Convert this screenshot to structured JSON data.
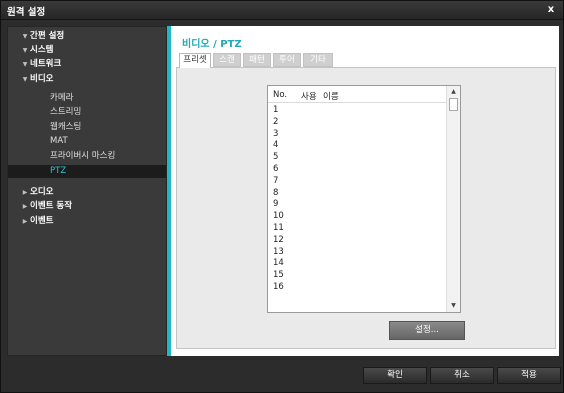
{
  "window": {
    "title": "원격 설정",
    "close_label": "x"
  },
  "sidebar": {
    "items": [
      {
        "label": "간편 설정",
        "level": "top",
        "tri": "▼"
      },
      {
        "label": "시스템",
        "level": "top",
        "tri": "▼"
      },
      {
        "label": "네트워크",
        "level": "top",
        "tri": "▼"
      },
      {
        "label": "비디오",
        "level": "top",
        "tri": "▼"
      },
      {
        "label": "카메라",
        "level": "sub"
      },
      {
        "label": "스트리밍",
        "level": "sub"
      },
      {
        "label": "웹캐스팅",
        "level": "sub"
      },
      {
        "label": "MAT",
        "level": "sub"
      },
      {
        "label": "프라이버시 마스킹",
        "level": "sub"
      },
      {
        "label": "PTZ",
        "level": "sub",
        "selected": true
      },
      {
        "label": "오디오",
        "level": "top",
        "tri": "▶"
      },
      {
        "label": "이벤트 동작",
        "level": "top",
        "tri": "▶"
      },
      {
        "label": "이벤트",
        "level": "top",
        "tri": "▶"
      }
    ]
  },
  "main": {
    "title": "비디오 / PTZ",
    "tabs": [
      {
        "label": "프리셋",
        "active": true
      },
      {
        "label": "스캔",
        "active": false
      },
      {
        "label": "패턴",
        "active": false
      },
      {
        "label": "투어",
        "active": false
      },
      {
        "label": "기타",
        "active": false
      }
    ],
    "list": {
      "headers": {
        "no": "No.",
        "use": "사용",
        "name": "이름"
      },
      "rows": [
        "1",
        "2",
        "3",
        "4",
        "5",
        "6",
        "7",
        "8",
        "9",
        "10",
        "11",
        "12",
        "13",
        "14",
        "15",
        "16"
      ],
      "scroll_up": "▲",
      "scroll_down": "▼"
    },
    "settings_label": "설정..."
  },
  "footer": {
    "ok_label": "확인",
    "cancel_label": "취소",
    "apply_label": "적용"
  },
  "colors": {
    "accent": "#20b8c4",
    "title_accent": "#1ea9b4",
    "selected_text": "#35c4d0"
  }
}
